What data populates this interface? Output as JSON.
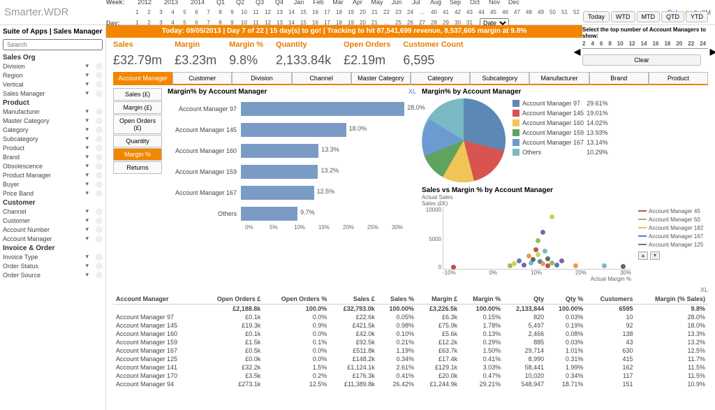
{
  "app": {
    "logo1": "Smarter",
    "logo2": ".",
    "logo3": "WDR",
    "breadcrumb": "Suite of Apps | Sales Manager"
  },
  "role": {
    "label": "Role",
    "value": "SM"
  },
  "calendar": {
    "week_label": "Week:",
    "day_label": "Day:",
    "years": [
      "2012",
      "2013",
      "2014"
    ],
    "quarters": [
      "Q1",
      "Q2",
      "Q3",
      "Q4"
    ],
    "months": [
      "Jan",
      "Feb",
      "Mar",
      "Apr",
      "May",
      "Jun",
      "Jul",
      "Aug",
      "Sep",
      "Oct",
      "Nov",
      "Dec"
    ],
    "weeks": [
      "1",
      "2",
      "3",
      "4",
      "5",
      "6",
      "7",
      "8",
      "9",
      "10",
      "11",
      "12",
      "13",
      "14",
      "15",
      "16",
      "17",
      "18",
      "19",
      "20",
      "21",
      "22",
      "23",
      "24",
      "...",
      "40",
      "41",
      "42",
      "43",
      "44",
      "45",
      "46",
      "47",
      "48",
      "49",
      "50",
      "51",
      "52"
    ],
    "days": [
      "1",
      "2",
      "3",
      "4",
      "5",
      "6",
      "7",
      "8",
      "9",
      "10",
      "11",
      "12",
      "13",
      "14",
      "15",
      "16",
      "17",
      "18",
      "19",
      "20",
      "21",
      "...",
      "25",
      "26",
      "27",
      "28",
      "29",
      "30",
      "31"
    ],
    "date_label": "Date"
  },
  "status": "Today: 09/05/2013   |   Day 7 of 22   |   15 day(s) to go!   |   Tracking to hit 87,541,699 revenue,   8,537,605 margin at 9.8%",
  "timebtns": [
    "Today",
    "WTD",
    "MTD",
    "QTD",
    "YTD"
  ],
  "clear": "Clear",
  "slider": {
    "label": "Select the top number of Account Managers to show:",
    "ticks": [
      "2",
      "4",
      "6",
      "8",
      "10",
      "12",
      "14",
      "16",
      "18",
      "20",
      "22",
      "24"
    ]
  },
  "kpis": [
    {
      "l": "Sales",
      "v": "£32.79m"
    },
    {
      "l": "Margin",
      "v": "£3.23m"
    },
    {
      "l": "Margin %",
      "v": "9.8%"
    },
    {
      "l": "Quantity",
      "v": "2,133.84k"
    },
    {
      "l": "Open Orders",
      "v": "£2.19m"
    },
    {
      "l": "Customer Count",
      "v": "6,595"
    }
  ],
  "search_ph": "Search",
  "sidebar": {
    "groups": [
      {
        "h": "Sales Org",
        "items": [
          "Division",
          "Region",
          "Vertical",
          "Sales Manager"
        ]
      },
      {
        "h": "Product",
        "items": [
          "Manufacturer",
          "Master Category",
          "Category",
          "Subcategory",
          "Product",
          "Brand",
          "Obsolescence",
          "Product Manager",
          "Buyer",
          "Price Band"
        ]
      },
      {
        "h": "Customer",
        "items": [
          "Channel",
          "Customer",
          "Account Number",
          "Account Manager"
        ]
      },
      {
        "h": "Invoice & Order",
        "items": [
          "Invoice Type",
          "Order Status",
          "Order Source"
        ]
      }
    ]
  },
  "tabs": [
    "Account Manager",
    "Customer",
    "Division",
    "Channel",
    "Master Category",
    "Category",
    "Subcategory",
    "Manufacturer",
    "Brand",
    "Product"
  ],
  "metrics": [
    "Sales (£)",
    "Margin (£)",
    "Open Orders (£)",
    "Quantity",
    "Margin %",
    "Returns"
  ],
  "chart_data": [
    {
      "type": "bar",
      "title": "Margin% by Account Manager",
      "xlabel": "",
      "ylabel": "",
      "ylim": [
        0,
        30
      ],
      "categories": [
        "Account Manager 97",
        "Account Manager 145",
        "Account Manager 160",
        "Account Manager 159",
        "Account Manager 167",
        "Others"
      ],
      "values": [
        28.0,
        18.0,
        13.3,
        13.2,
        12.5,
        9.7
      ],
      "axis": [
        "0%",
        "5%",
        "10%",
        "15%",
        "20%",
        "25%",
        "30%"
      ]
    },
    {
      "type": "pie",
      "title": "Margin% by Account Manager",
      "categories": [
        "Account Manager 97",
        "Account Manager 145",
        "Account Manager 160",
        "Account Manager 159",
        "Account Manager 167",
        "Others"
      ],
      "values": [
        29.61,
        19.01,
        14.02,
        13.93,
        13.14,
        10.29
      ],
      "colors": [
        "#5b89b4",
        "#d9534f",
        "#f0c457",
        "#5fa35f",
        "#6c9bd1",
        "#7ab8c4"
      ]
    },
    {
      "type": "scatter",
      "title": "Sales vs Margin % by Account Manager",
      "xlabel": "Actual Margin %",
      "ylabel": "Actual Sales\nSales (£K)",
      "xlim": [
        -10,
        30
      ],
      "ylim": [
        0,
        10000
      ],
      "xticks": [
        "-10%",
        "0%",
        "10%",
        "20%",
        "30%"
      ],
      "yticks": [
        "0",
        "5000",
        "10000"
      ],
      "series": [
        {
          "name": "Account Manager 45",
          "color": "#c0504d"
        },
        {
          "name": "Account Manager 50",
          "color": "#9bbb59"
        },
        {
          "name": "Account Manager 182",
          "color": "#d2d252"
        },
        {
          "name": "Account Manager 167",
          "color": "#4f81bd"
        },
        {
          "name": "Account Manager 125",
          "color": "#8064a2"
        }
      ],
      "points": [
        [
          -8,
          200
        ],
        [
          4,
          400
        ],
        [
          5,
          800
        ],
        [
          6,
          1200
        ],
        [
          7,
          600
        ],
        [
          8,
          2000
        ],
        [
          8.5,
          900
        ],
        [
          9,
          1500
        ],
        [
          9.5,
          3000
        ],
        [
          10,
          4500
        ],
        [
          10,
          2200
        ],
        [
          10.5,
          1100
        ],
        [
          11,
          5800
        ],
        [
          11,
          800
        ],
        [
          11.5,
          2800
        ],
        [
          12,
          1600
        ],
        [
          12,
          400
        ],
        [
          13,
          900
        ],
        [
          13,
          8200
        ],
        [
          14,
          600
        ],
        [
          15,
          1200
        ],
        [
          18,
          500
        ],
        [
          24,
          400
        ],
        [
          28,
          350
        ]
      ]
    }
  ],
  "xl": "XL",
  "table": {
    "headers": [
      "Account Manager",
      "Open Orders £",
      "Open Orders %",
      "Sales £",
      "Sales %",
      "Margin £",
      "Margin %",
      "Qty",
      "Qty %",
      "Customers",
      "Margin (% Sales)"
    ],
    "total": [
      "",
      "£2,188.8k",
      "100.0%",
      "£32,793.0k",
      "100.00%",
      "£3,226.5k",
      "100.00%",
      "2,133,844",
      "100.00%",
      "6595",
      "9.8%"
    ],
    "rows": [
      [
        "Account Manager 97",
        "£0.1k",
        "0.0%",
        "£22.6k",
        "0.05%",
        "£6.3k",
        "0.15%",
        "820",
        "0.03%",
        "10",
        "28.0%"
      ],
      [
        "Account Manager 145",
        "£19.3k",
        "0.9%",
        "£421.5k",
        "0.98%",
        "£75.9k",
        "1.78%",
        "5,497",
        "0.19%",
        "92",
        "18.0%"
      ],
      [
        "Account Manager 160",
        "£0.1k",
        "0.0%",
        "£42.0k",
        "0.10%",
        "£5.6k",
        "0.13%",
        "2,466",
        "0.08%",
        "138",
        "13.3%"
      ],
      [
        "Account Manager 159",
        "£1.5k",
        "0.1%",
        "£92.5k",
        "0.21%",
        "£12.2k",
        "0.29%",
        "885",
        "0.03%",
        "43",
        "13.2%"
      ],
      [
        "Account Manager 167",
        "£0.5k",
        "0.0%",
        "£511.8k",
        "1.19%",
        "£63.7k",
        "1.50%",
        "29,714",
        "1.01%",
        "630",
        "12.5%"
      ],
      [
        "Account Manager 125",
        "£0.0k",
        "0.0%",
        "£148.2k",
        "0.34%",
        "£17.4k",
        "0.41%",
        "8,990",
        "0.31%",
        "415",
        "11.7%"
      ],
      [
        "Account Manager 141",
        "£32.2k",
        "1.5%",
        "£1,124.1k",
        "2.61%",
        "£129.1k",
        "3.03%",
        "58,441",
        "1.99%",
        "162",
        "11.5%"
      ],
      [
        "Account Manager 170",
        "£3.5k",
        "0.2%",
        "£176.3k",
        "0.41%",
        "£20.0k",
        "0.47%",
        "10,020",
        "0.34%",
        "117",
        "11.5%"
      ],
      [
        "Account Manager 94",
        "£273.1k",
        "12.5%",
        "£11,389.8k",
        "26.42%",
        "£1,244.9k",
        "29.21%",
        "548,947",
        "18.71%",
        "151",
        "10.9%"
      ]
    ]
  }
}
